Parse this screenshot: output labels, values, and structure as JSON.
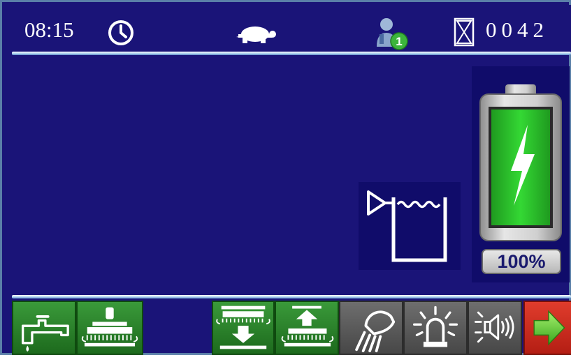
{
  "status_bar": {
    "time": "08:15",
    "clock_icon": "clock-icon",
    "speed_mode_icon": "turtle-icon",
    "operator_icon": "user-icon",
    "operator_badge": "1",
    "hour_meter_icon": "hourglass-icon",
    "hour_counter": "0042"
  },
  "main": {
    "tank_icon": "water-tank-icon",
    "battery": {
      "charge_percent": 100,
      "label": "100%",
      "icon": "battery-charging-icon"
    }
  },
  "buttons": [
    {
      "id": "water-tap",
      "icon": "water-tap-icon",
      "state": "green"
    },
    {
      "id": "brush-pressure",
      "icon": "brush-pressure-icon",
      "state": "green"
    },
    {
      "id": "brush-deck-down",
      "icon": "brush-deck-down-icon",
      "state": "green"
    },
    {
      "id": "brush-deck-up",
      "icon": "brush-deck-up-icon",
      "state": "green"
    },
    {
      "id": "work-light",
      "icon": "work-light-icon",
      "state": "gray"
    },
    {
      "id": "beacon",
      "icon": "beacon-light-icon",
      "state": "gray"
    },
    {
      "id": "horn",
      "icon": "horn-icon",
      "state": "gray"
    },
    {
      "id": "next",
      "icon": "arrow-right-icon",
      "state": "red"
    }
  ],
  "colors": {
    "background": "#1a1478",
    "active_button": "#2e8a2e",
    "inactive_button": "#5a5a5a",
    "next_button": "#d42e20",
    "battery_fill": "#2ac82a"
  }
}
